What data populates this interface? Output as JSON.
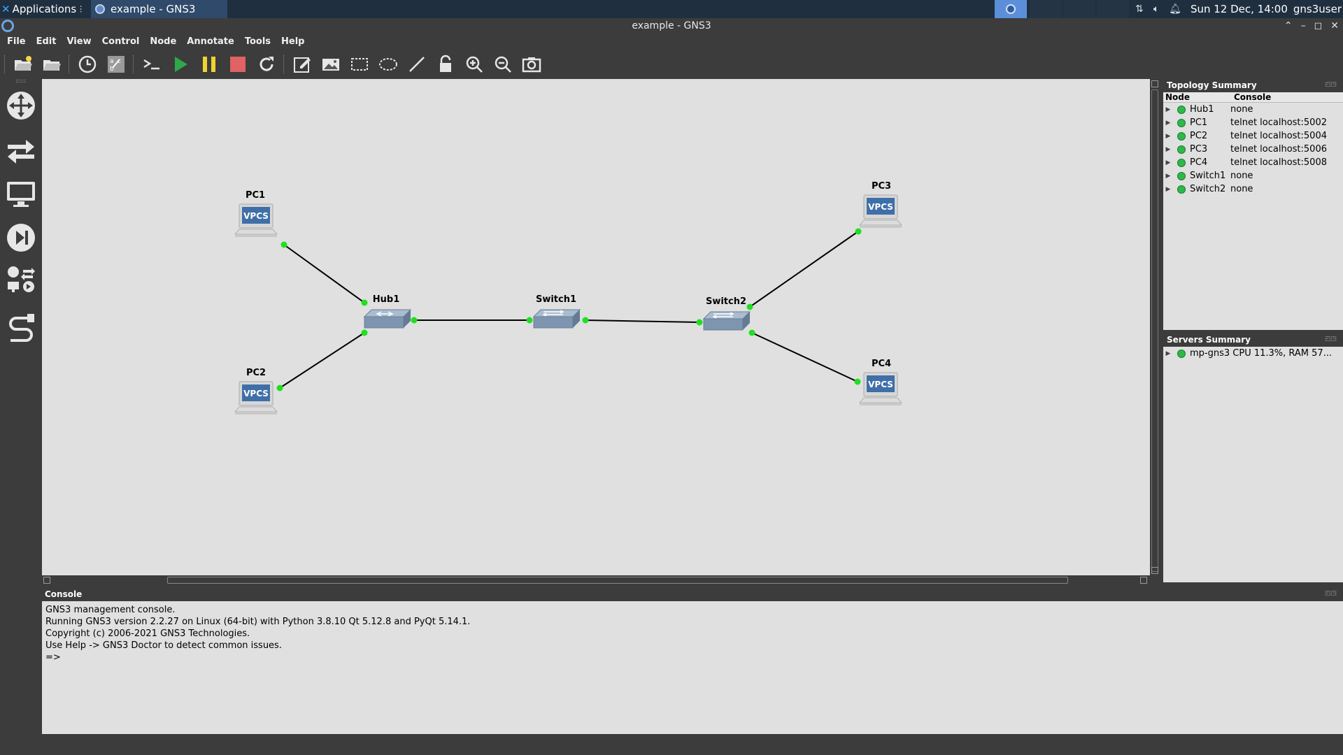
{
  "taskbar": {
    "applications_label": "Applications",
    "window_title": "example - GNS3",
    "clock": "Sun 12 Dec, 14:00",
    "user": "gns3user"
  },
  "window": {
    "title": "example - GNS3"
  },
  "menu": [
    "File",
    "Edit",
    "View",
    "Control",
    "Node",
    "Annotate",
    "Tools",
    "Help"
  ],
  "toolbar_icons": [
    "open-project-icon",
    "open-folder-icon",
    "snapshot-clock-icon",
    "show-interface-labels-icon",
    "console-all-icon",
    "start-all-icon",
    "suspend-all-icon",
    "stop-all-icon",
    "reload-all-icon",
    "add-note-icon",
    "insert-picture-icon",
    "draw-rectangle-icon",
    "draw-ellipse-icon",
    "draw-line-icon",
    "lock-items-icon",
    "zoom-in-icon",
    "zoom-out-icon",
    "screenshot-icon"
  ],
  "topology": {
    "title": "Topology Summary",
    "col_node": "Node",
    "col_console": "Console",
    "rows": [
      {
        "node": "Hub1",
        "console": "none"
      },
      {
        "node": "PC1",
        "console": "telnet localhost:5002"
      },
      {
        "node": "PC2",
        "console": "telnet localhost:5004"
      },
      {
        "node": "PC3",
        "console": "telnet localhost:5006"
      },
      {
        "node": "PC4",
        "console": "telnet localhost:5008"
      },
      {
        "node": "Switch1",
        "console": "none"
      },
      {
        "node": "Switch2",
        "console": "none"
      }
    ]
  },
  "servers": {
    "title": "Servers Summary",
    "row": "mp-gns3 CPU 11.3%, RAM 57..."
  },
  "canvas": {
    "nodes": {
      "pc1": "PC1",
      "pc2": "PC2",
      "pc3": "PC3",
      "pc4": "PC4",
      "hub1": "Hub1",
      "switch1": "Switch1",
      "switch2": "Switch2"
    },
    "vpcs_badge": "VPCS"
  },
  "console": {
    "title": "Console",
    "lines": [
      "GNS3 management console.",
      "Running GNS3 version 2.2.27 on Linux (64-bit) with Python 3.8.10 Qt 5.12.8 and PyQt 5.14.1.",
      "Copyright (c) 2006-2021 GNS3 Technologies.",
      "Use Help -> GNS3 Doctor to detect common issues.",
      "",
      "=>"
    ]
  },
  "colors": {
    "link_endpoint": "#1fe01f",
    "canvas_bg": "#e0e0e0",
    "start_green": "#2fa84a",
    "suspend_yellow": "#f2d22c",
    "stop_red": "#e06262"
  }
}
